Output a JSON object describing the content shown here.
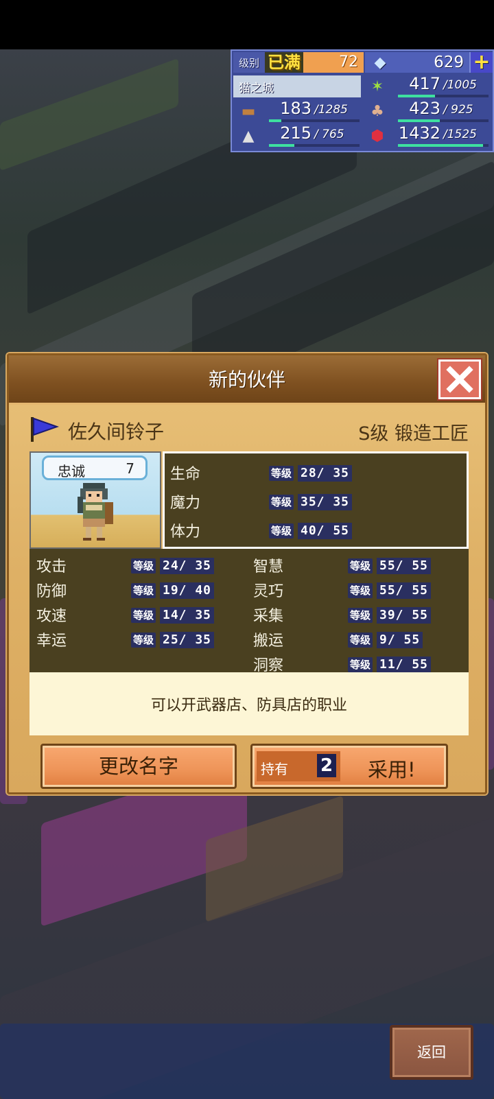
{
  "hud": {
    "level_label": "级别",
    "level_max": "已满",
    "level_value": "72",
    "gems": "629",
    "town_name": "猫之城",
    "resources": [
      {
        "icon": "grass-icon",
        "value": "417",
        "max": "/1005",
        "fill": 0.41
      },
      {
        "icon": "wood-icon",
        "value": "183",
        "max": "/1285",
        "fill": 0.14
      },
      {
        "icon": "food-icon",
        "value": "423",
        "max": "/ 925",
        "fill": 0.46
      },
      {
        "icon": "ore-icon",
        "value": "215",
        "max": "/ 765",
        "fill": 0.28
      },
      {
        "icon": "ruby-icon",
        "value": "1432",
        "max": "/1525",
        "fill": 0.94
      }
    ],
    "colors": {
      "panel": "#3c4a96",
      "bar": "#3ee0a0"
    }
  },
  "dialog": {
    "title": "新的伙伴",
    "char_name": "佐久间铃子",
    "char_job": "S级 锻造工匠",
    "loyalty_label": "忠诚",
    "loyalty_value": "7",
    "level_tag": "等级",
    "top_stats": [
      {
        "name": "生命",
        "value": "28/ 35"
      },
      {
        "name": "魔力",
        "value": "35/ 35"
      },
      {
        "name": "体力",
        "value": "40/ 55"
      }
    ],
    "left_stats": [
      {
        "name": "攻击",
        "value": "24/ 35"
      },
      {
        "name": "防御",
        "value": "19/ 40"
      },
      {
        "name": "攻速",
        "value": "14/ 35"
      },
      {
        "name": "幸运",
        "value": "25/ 35"
      }
    ],
    "right_stats": [
      {
        "name": "智慧",
        "value": "55/ 55"
      },
      {
        "name": "灵巧",
        "value": "55/ 55"
      },
      {
        "name": "采集",
        "value": "39/ 55"
      },
      {
        "name": "搬运",
        "value": " 9/ 55"
      },
      {
        "name": "洞察",
        "value": "11/ 55"
      }
    ],
    "description": "可以开武器店、防具店的职业",
    "rename_label": "更改名字",
    "own_label": "持有",
    "own_count": "2",
    "adopt_label": "采用!"
  },
  "back_label": "返回"
}
